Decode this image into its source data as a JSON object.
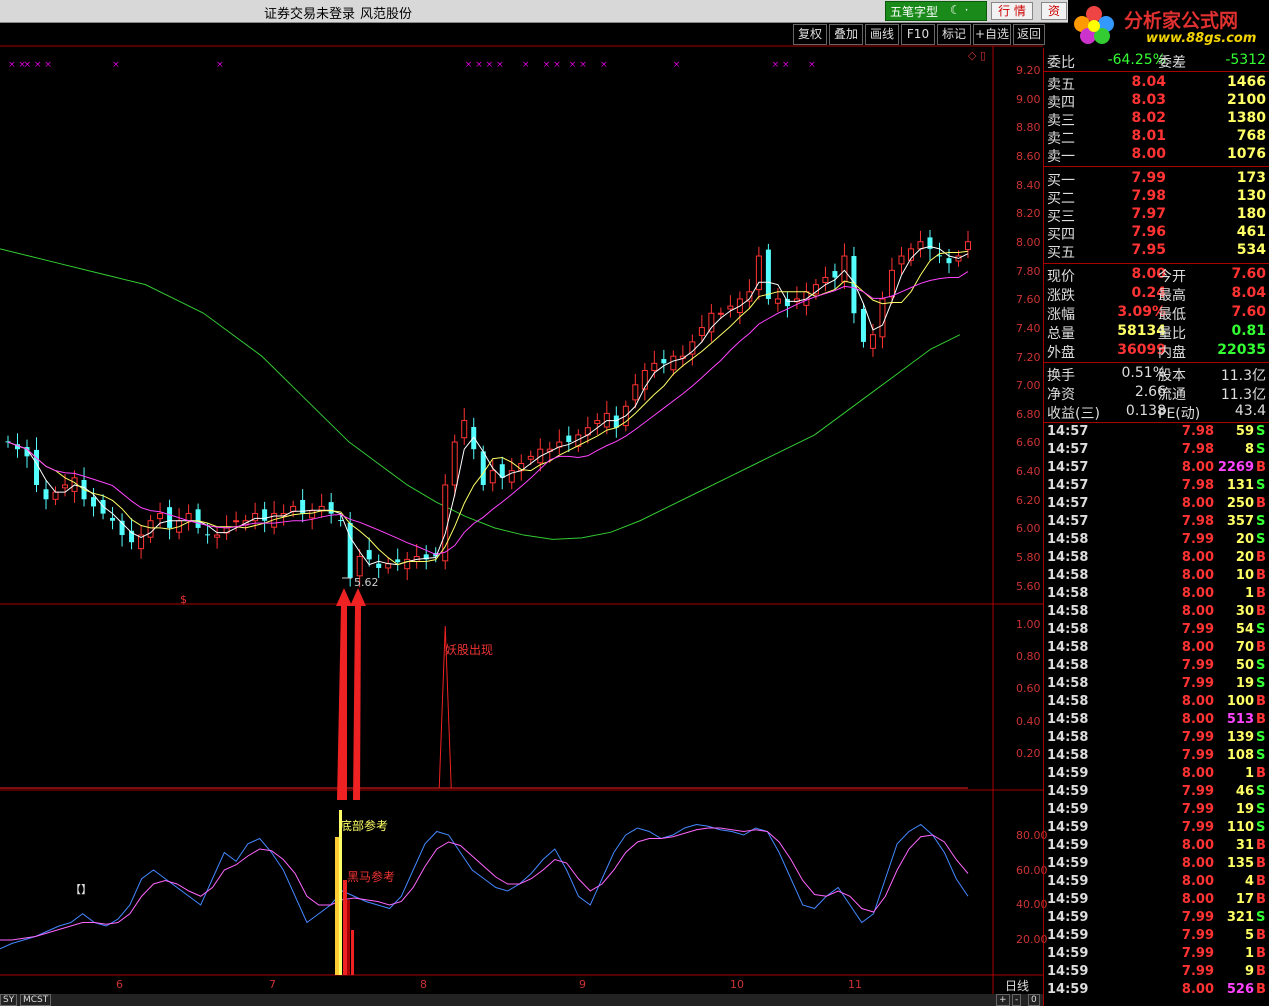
{
  "titlebar": {
    "status": "证券交易未登录",
    "stock": "风范股份",
    "ime": "五笔字型",
    "hq_btn": "行 情",
    "zi_btn": "资"
  },
  "logo": {
    "name": "分析家公式网",
    "url": "www.88gs.com"
  },
  "toolbar": [
    "复权",
    "叠加",
    "画线",
    "F10",
    "标记",
    "+自选",
    "返回"
  ],
  "colors": {
    "up": "#ff3333",
    "down": "#54ffff",
    "ma5": "#ffffff",
    "ma10": "#ffff66",
    "ma20": "#ff44ff",
    "ma60": "#33cc33",
    "kdj_k": "#4488ff",
    "kdj_d": "#ff66ff"
  },
  "price_axis": [
    "9.20",
    "9.00",
    "8.80",
    "8.60",
    "8.40",
    "8.20",
    "8.00",
    "7.80",
    "7.60",
    "7.40",
    "7.20",
    "7.00",
    "6.80",
    "6.60",
    "6.40",
    "6.20",
    "6.00",
    "5.80",
    "5.60"
  ],
  "ind_axis": [
    "1.00",
    "0.80",
    "0.60",
    "0.40",
    "0.20"
  ],
  "kdj_axis": [
    "80.00",
    "60.00",
    "40.00",
    "20.00"
  ],
  "xlabels": [
    "6",
    "7",
    "8",
    "9",
    "10",
    "11"
  ],
  "period": "日线",
  "low_label": "5.62",
  "annotations": {
    "yaogu": "妖股出现",
    "dibu": "底部参考",
    "heima": "黑马参考",
    "dollar": "$"
  },
  "bottom_tabs": [
    "SY",
    "MCST"
  ],
  "bottom_ctrl": [
    "+",
    "-",
    "0"
  ],
  "weibi": {
    "l1": "委比",
    "v1": "-64.25%",
    "l2": "委差",
    "v2": "-5312"
  },
  "sell": [
    {
      "label": "卖五",
      "price": "8.04",
      "vol": "1466"
    },
    {
      "label": "卖四",
      "price": "8.03",
      "vol": "2100"
    },
    {
      "label": "卖三",
      "price": "8.02",
      "vol": "1380"
    },
    {
      "label": "卖二",
      "price": "8.01",
      "vol": "768"
    },
    {
      "label": "卖一",
      "price": "8.00",
      "vol": "1076"
    }
  ],
  "buy": [
    {
      "label": "买一",
      "price": "7.99",
      "vol": "173"
    },
    {
      "label": "买二",
      "price": "7.98",
      "vol": "130"
    },
    {
      "label": "买三",
      "price": "7.97",
      "vol": "180"
    },
    {
      "label": "买四",
      "price": "7.96",
      "vol": "461"
    },
    {
      "label": "买五",
      "price": "7.95",
      "vol": "534"
    }
  ],
  "quote": [
    {
      "l1": "现价",
      "v1": "8.00",
      "c1": "#ff3333",
      "l2": "今开",
      "v2": "7.60",
      "c2": "#ff3333"
    },
    {
      "l1": "涨跌",
      "v1": "0.24",
      "c1": "#ff3333",
      "l2": "最高",
      "v2": "8.04",
      "c2": "#ff3333"
    },
    {
      "l1": "涨幅",
      "v1": "3.09%",
      "c1": "#ff3333",
      "l2": "最低",
      "v2": "7.60",
      "c2": "#ff3333"
    },
    {
      "l1": "总量",
      "v1": "58134",
      "c1": "#ffff66",
      "l2": "量比",
      "v2": "0.81",
      "c2": "#33ff33"
    },
    {
      "l1": "外盘",
      "v1": "36099",
      "c1": "#ff3333",
      "l2": "内盘",
      "v2": "22035",
      "c2": "#33ff33"
    }
  ],
  "fund": [
    {
      "l1": "换手",
      "v1": "0.51%",
      "l2": "股本",
      "v2": "11.3亿"
    },
    {
      "l1": "净资",
      "v1": "2.66",
      "l2": "流通",
      "v2": "11.3亿"
    },
    {
      "l1": "收益(三)",
      "v1": "0.138",
      "l2": "PE(动)",
      "v2": "43.4"
    }
  ],
  "ticks": [
    [
      "14:57",
      "7.98",
      "59",
      "S"
    ],
    [
      "14:57",
      "7.98",
      "8",
      "S"
    ],
    [
      "14:57",
      "8.00",
      "2269",
      "B"
    ],
    [
      "14:57",
      "7.98",
      "131",
      "S"
    ],
    [
      "14:57",
      "8.00",
      "250",
      "B"
    ],
    [
      "14:57",
      "7.98",
      "357",
      "S"
    ],
    [
      "14:58",
      "7.99",
      "20",
      "S"
    ],
    [
      "14:58",
      "8.00",
      "20",
      "B"
    ],
    [
      "14:58",
      "8.00",
      "10",
      "B"
    ],
    [
      "14:58",
      "8.00",
      "1",
      "B"
    ],
    [
      "14:58",
      "8.00",
      "30",
      "B"
    ],
    [
      "14:58",
      "7.99",
      "54",
      "S"
    ],
    [
      "14:58",
      "8.00",
      "70",
      "B"
    ],
    [
      "14:58",
      "7.99",
      "50",
      "S"
    ],
    [
      "14:58",
      "7.99",
      "19",
      "S"
    ],
    [
      "14:58",
      "8.00",
      "100",
      "B"
    ],
    [
      "14:58",
      "8.00",
      "513",
      "B"
    ],
    [
      "14:58",
      "7.99",
      "139",
      "S"
    ],
    [
      "14:58",
      "7.99",
      "108",
      "S"
    ],
    [
      "14:59",
      "8.00",
      "1",
      "B"
    ],
    [
      "14:59",
      "7.99",
      "46",
      "S"
    ],
    [
      "14:59",
      "7.99",
      "19",
      "S"
    ],
    [
      "14:59",
      "7.99",
      "110",
      "S"
    ],
    [
      "14:59",
      "8.00",
      "31",
      "B"
    ],
    [
      "14:59",
      "8.00",
      "135",
      "B"
    ],
    [
      "14:59",
      "8.00",
      "4",
      "B"
    ],
    [
      "14:59",
      "8.00",
      "17",
      "B"
    ],
    [
      "14:59",
      "7.99",
      "321",
      "S"
    ],
    [
      "14:59",
      "7.99",
      "5",
      "B"
    ],
    [
      "14:59",
      "7.99",
      "1",
      "B"
    ],
    [
      "14:59",
      "7.99",
      "9",
      "B"
    ],
    [
      "14:59",
      "8.00",
      "526",
      "B"
    ]
  ],
  "chart_data": {
    "type": "candlestick",
    "ylim": [
      5.5,
      9.3
    ],
    "closes": [
      6.6,
      6.55,
      6.5,
      6.3,
      6.2,
      6.25,
      6.3,
      6.35,
      6.2,
      6.15,
      6.1,
      6.05,
      5.95,
      5.9,
      5.95,
      6.05,
      6.1,
      6.0,
      6.05,
      6.1,
      6.0,
      5.95,
      5.95,
      6.0,
      6.05,
      6.05,
      6.1,
      6.05,
      6.1,
      6.1,
      6.15,
      6.1,
      6.12,
      6.15,
      6.1,
      6.05,
      5.65,
      5.8,
      5.78,
      5.72,
      5.75,
      5.76,
      5.78,
      5.8,
      5.78,
      5.8,
      6.3,
      6.6,
      6.75,
      6.55,
      6.3,
      6.4,
      6.35,
      6.4,
      6.45,
      6.5,
      6.55,
      6.55,
      6.6,
      6.6,
      6.65,
      6.7,
      6.75,
      6.8,
      6.7,
      6.85,
      7.0,
      7.1,
      7.15,
      7.15,
      7.2,
      7.2,
      7.3,
      7.4,
      7.5,
      7.5,
      7.55,
      7.6,
      7.65,
      7.9,
      7.6,
      7.6,
      7.55,
      7.6,
      7.65,
      7.7,
      7.75,
      7.75,
      7.9,
      7.5,
      7.3,
      7.35,
      7.6,
      7.8,
      7.9,
      7.95,
      8.0,
      7.95,
      7.9,
      7.85,
      7.9,
      8.0
    ],
    "ma60_trend": [
      7.95,
      7.9,
      7.85,
      7.8,
      7.75,
      7.7,
      7.6,
      7.5,
      7.35,
      7.2,
      7.0,
      6.8,
      6.6,
      6.45,
      6.3,
      6.18,
      6.08,
      6.0,
      5.95,
      5.92,
      5.93,
      5.97,
      6.05,
      6.15,
      6.25,
      6.35,
      6.45,
      6.55,
      6.65,
      6.8,
      6.95,
      7.1,
      7.25,
      7.35
    ],
    "signals_yaogu": [
      {
        "at": 46,
        "value": 1.0
      }
    ],
    "kdj_k": [
      15,
      18,
      20,
      22,
      25,
      28,
      30,
      35,
      30,
      28,
      32,
      40,
      55,
      60,
      55,
      50,
      45,
      40,
      55,
      70,
      65,
      75,
      78,
      70,
      60,
      45,
      30,
      35,
      40,
      48,
      45,
      42,
      40,
      38,
      45,
      60,
      75,
      82,
      80,
      70,
      60,
      55,
      50,
      48,
      52,
      58,
      66,
      72,
      60,
      45,
      40,
      55,
      70,
      80,
      84,
      82,
      78,
      80,
      84,
      86,
      85,
      83,
      82,
      80,
      84,
      82,
      70,
      55,
      40,
      38,
      45,
      50,
      40,
      30,
      35,
      55,
      75,
      82,
      86,
      80,
      70,
      55,
      45
    ],
    "kdj_d": [
      20,
      20,
      21,
      22,
      24,
      26,
      28,
      30,
      30,
      29,
      30,
      35,
      45,
      52,
      54,
      52,
      48,
      45,
      50,
      60,
      63,
      68,
      72,
      71,
      66,
      58,
      45,
      40,
      40,
      43,
      44,
      43,
      42,
      40,
      42,
      50,
      62,
      72,
      76,
      74,
      68,
      62,
      56,
      52,
      52,
      55,
      60,
      66,
      64,
      55,
      48,
      52,
      60,
      70,
      76,
      78,
      78,
      79,
      81,
      83,
      84,
      84,
      83,
      82,
      83,
      82,
      76,
      66,
      54,
      46,
      45,
      48,
      45,
      38,
      36,
      45,
      60,
      72,
      79,
      80,
      76,
      66,
      58
    ]
  }
}
